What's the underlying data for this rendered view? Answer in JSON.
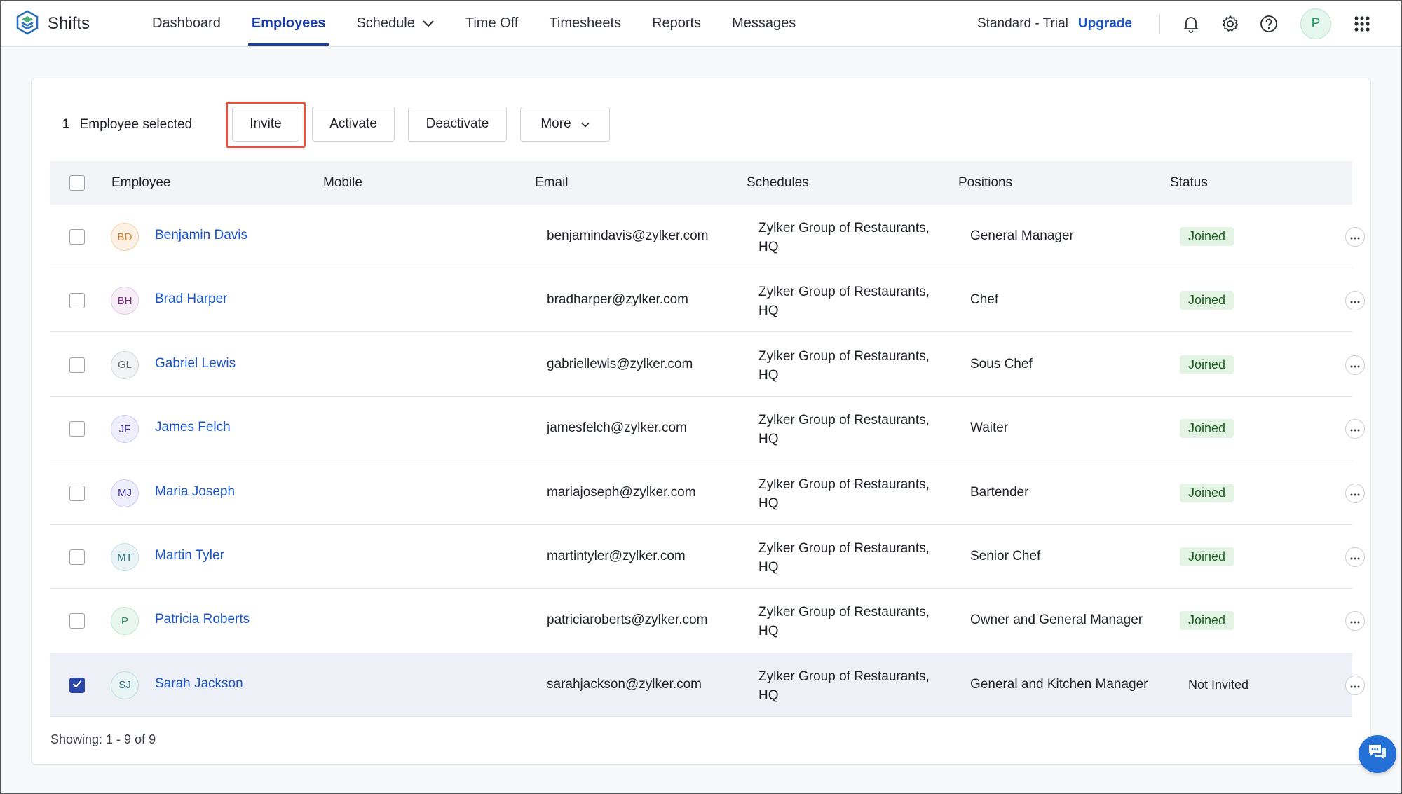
{
  "app": {
    "name": "Shifts"
  },
  "nav": {
    "items": [
      {
        "label": "Dashboard"
      },
      {
        "label": "Employees"
      },
      {
        "label": "Schedule"
      },
      {
        "label": "Time Off"
      },
      {
        "label": "Timesheets"
      },
      {
        "label": "Reports"
      },
      {
        "label": "Messages"
      }
    ],
    "active": "Employees"
  },
  "plan": {
    "label": "Standard - Trial",
    "upgrade": "Upgrade"
  },
  "user": {
    "initial": "P"
  },
  "toolbar": {
    "count": "1",
    "selected_text": "Employee selected",
    "invite": "Invite",
    "activate": "Activate",
    "deactivate": "Deactivate",
    "more": "More"
  },
  "table": {
    "headers": [
      "Employee",
      "Mobile",
      "Email",
      "Schedules",
      "Positions",
      "Status"
    ],
    "rows": [
      {
        "initials": "BD",
        "name": "Benjamin Davis",
        "mobile": "",
        "email": "benjamindavis@zylker.com",
        "schedule_line1": "Zylker Group of Restaurants,",
        "schedule_line2": "HQ",
        "position": "General Manager",
        "status": "Joined",
        "checked": false
      },
      {
        "initials": "BH",
        "name": "Brad Harper",
        "mobile": "",
        "email": "bradharper@zylker.com",
        "schedule_line1": "Zylker Group of Restaurants,",
        "schedule_line2": "HQ",
        "position": "Chef",
        "status": "Joined",
        "checked": false
      },
      {
        "initials": "GL",
        "name": "Gabriel Lewis",
        "mobile": "",
        "email": "gabriellewis@zylker.com",
        "schedule_line1": "Zylker Group of Restaurants,",
        "schedule_line2": "HQ",
        "position": "Sous Chef",
        "status": "Joined",
        "checked": false
      },
      {
        "initials": "JF",
        "name": "James Felch",
        "mobile": "",
        "email": "jamesfelch@zylker.com",
        "schedule_line1": "Zylker Group of Restaurants,",
        "schedule_line2": "HQ",
        "position": "Waiter",
        "status": "Joined",
        "checked": false
      },
      {
        "initials": "MJ",
        "name": "Maria Joseph",
        "mobile": "",
        "email": "mariajoseph@zylker.com",
        "schedule_line1": "Zylker Group of Restaurants,",
        "schedule_line2": "HQ",
        "position": "Bartender",
        "status": "Joined",
        "checked": false
      },
      {
        "initials": "MT",
        "name": "Martin Tyler",
        "mobile": "",
        "email": "martintyler@zylker.com",
        "schedule_line1": "Zylker Group of Restaurants,",
        "schedule_line2": "HQ",
        "position": "Senior Chef",
        "status": "Joined",
        "checked": false
      },
      {
        "initials": "P",
        "name": "Patricia Roberts",
        "mobile": "",
        "email": "patriciaroberts@zylker.com",
        "schedule_line1": "Zylker Group of Restaurants,",
        "schedule_line2": "HQ",
        "position": "Owner and General Manager",
        "status": "Joined",
        "checked": false
      },
      {
        "initials": "SJ",
        "name": "Sarah Jackson",
        "mobile": "",
        "email": "sarahjackson@zylker.com",
        "schedule_line1": "Zylker Group of Restaurants,",
        "schedule_line2": "HQ",
        "position": "General and Kitchen Manager",
        "status": "Not Invited",
        "checked": true
      }
    ]
  },
  "footer": {
    "showing": "Showing: 1 - 9 of 9"
  },
  "colors": {
    "accent": "#1b3fa6",
    "link": "#1b56c9",
    "joined_bg": "#e3f4e5",
    "highlight": "#e0533f",
    "chat": "#2470d6"
  },
  "avatar_colors": [
    {
      "bg": "#fdf1e6",
      "border": "#f3cfa8",
      "fg": "#d9822b"
    },
    {
      "bg": "#f7edf7",
      "border": "#e2c8e6",
      "fg": "#7a2b85"
    },
    {
      "bg": "#f2f3f4",
      "border": "#d4d7db",
      "fg": "#5f6670"
    },
    {
      "bg": "#efeefc",
      "border": "#cfcdf3",
      "fg": "#3d35a8"
    },
    {
      "bg": "#efeefc",
      "border": "#cfcdf3",
      "fg": "#3d35a8"
    },
    {
      "bg": "#eaf4f6",
      "border": "#c3dfe4",
      "fg": "#2b6f7e"
    },
    {
      "bg": "#e9f7f0",
      "border": "#bfe6d2",
      "fg": "#23905d"
    },
    {
      "bg": "#e9f4f5",
      "border": "#c0dde0",
      "fg": "#2f7581"
    }
  ],
  "icons": [
    "shifts-logo-icon",
    "chevron-down-icon",
    "bell-icon",
    "gear-icon",
    "help-icon",
    "apps-grid-icon",
    "more-dots-icon",
    "check-icon",
    "chat-icon"
  ]
}
